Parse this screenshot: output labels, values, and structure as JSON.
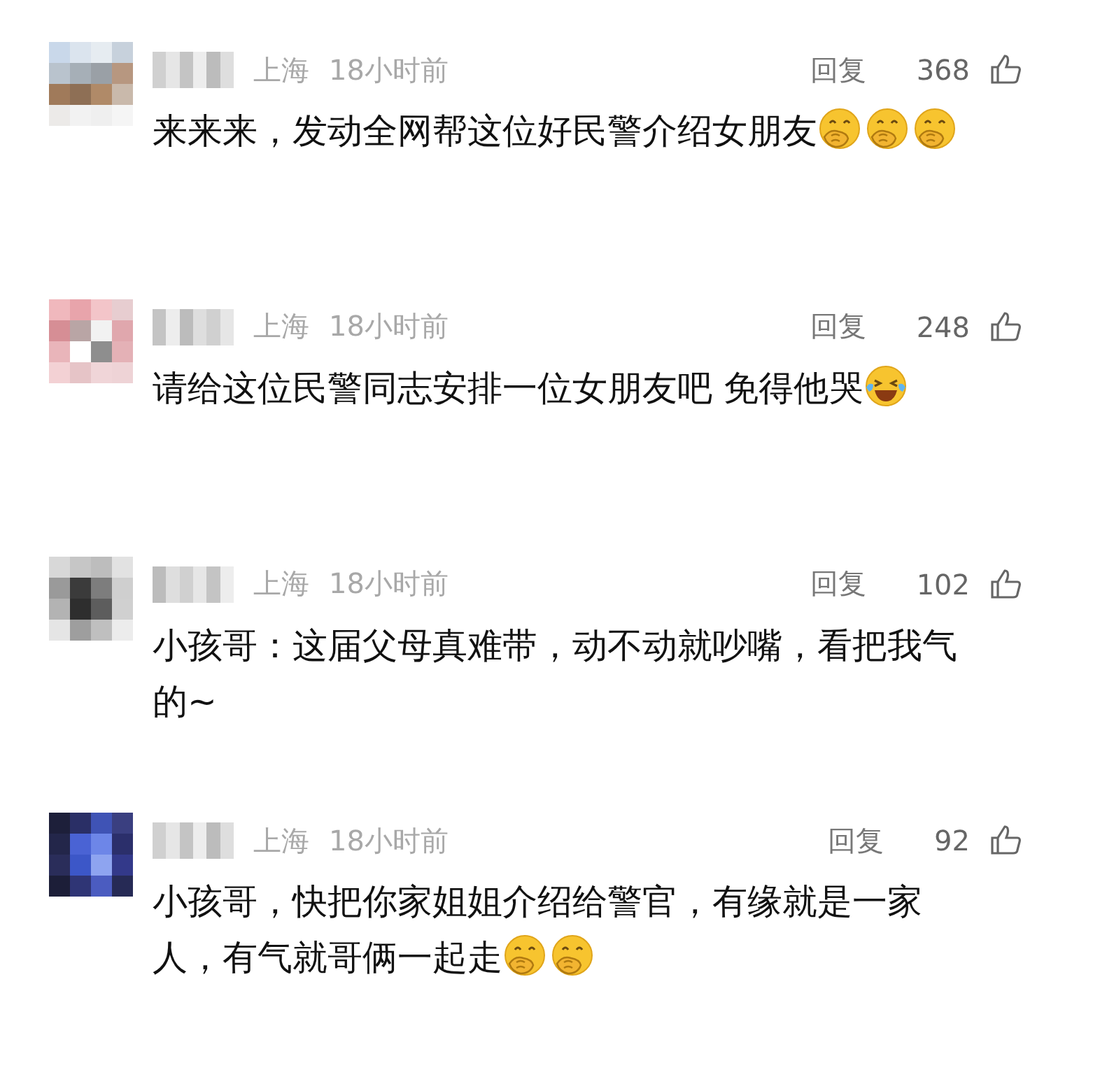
{
  "comments": [
    {
      "avatar": {
        "kind": "picture"
      },
      "location": "上海",
      "time": "18小时前",
      "reply": "回复",
      "likes": "368",
      "text": "来来来，发动全网帮这位好民警介绍女朋友",
      "emojis": [
        {
          "kind": "hand-over-mouth"
        },
        {
          "kind": "hand-over-mouth"
        },
        {
          "kind": "hand-over-mouth"
        }
      ]
    },
    {
      "avatar": {
        "kind": "picture"
      },
      "location": "上海",
      "time": "18小时前",
      "reply": "回复",
      "likes": "248",
      "text": "请给这位民警同志安排一位女朋友吧 免得他哭",
      "emojis": [
        {
          "kind": "tears-of-joy"
        }
      ]
    },
    {
      "avatar": {
        "kind": "picture"
      },
      "location": "上海",
      "time": "18小时前",
      "reply": "回复",
      "likes": "102",
      "text": "小孩哥：这届父母真难带，动不动就吵嘴，看把我气的~"
    },
    {
      "avatar": {
        "kind": "picture"
      },
      "location": "上海",
      "time": "18小时前",
      "reply": "回复",
      "likes": "92",
      "text": "小孩哥，快把你家姐姐介绍给警官，有缘就是一家人，有气就哥俩一起走",
      "emojis": [
        {
          "kind": "hand-over-mouth"
        },
        {
          "kind": "hand-over-mouth"
        }
      ]
    }
  ]
}
